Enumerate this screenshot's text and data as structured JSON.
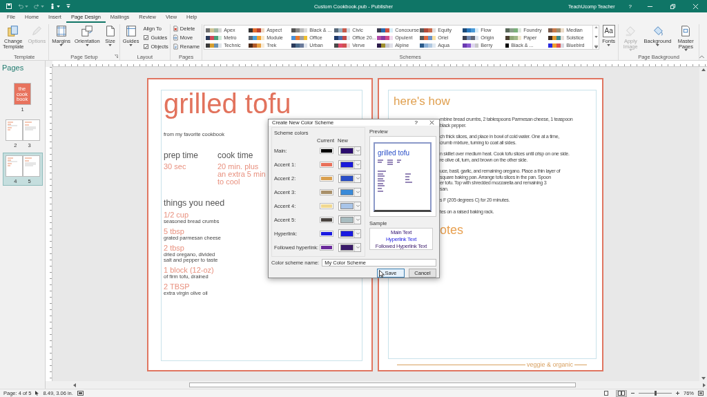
{
  "title_bar": {
    "quick_access": [
      {
        "kind": "save",
        "disabled": false,
        "dropdown": false
      },
      {
        "kind": "undo",
        "disabled": true,
        "dropdown": true
      },
      {
        "kind": "redo",
        "disabled": true,
        "dropdown": true
      },
      {
        "kind": "touch",
        "disabled": false,
        "dropdown": true
      },
      {
        "kind": "customize",
        "disabled": false,
        "dropdown": false
      }
    ],
    "document_title": "Custom Cookbook.pub - Publisher",
    "user": "TeachUcomp Teacher",
    "help": "?"
  },
  "tabs": [
    {
      "label": "File",
      "selected": false
    },
    {
      "label": "Home",
      "selected": false
    },
    {
      "label": "Insert",
      "selected": false
    },
    {
      "label": "Page Design",
      "selected": true
    },
    {
      "label": "Mailings",
      "selected": false
    },
    {
      "label": "Review",
      "selected": false
    },
    {
      "label": "View",
      "selected": false
    },
    {
      "label": "Help",
      "selected": false
    }
  ],
  "ribbon": {
    "groups": [
      {
        "label": "Template",
        "items": [
          {
            "kind": "large",
            "label": "Change Template",
            "disabled": false,
            "dropdown": false
          },
          {
            "kind": "large",
            "label": "Options",
            "disabled": true,
            "dropdown": false
          }
        ]
      },
      {
        "label": "Page Setup",
        "launcher": true,
        "items": [
          {
            "kind": "large",
            "label": "Margins",
            "disabled": false,
            "dropdown": true
          },
          {
            "kind": "large",
            "label": "Orientation",
            "disabled": false,
            "dropdown": true
          },
          {
            "kind": "large",
            "label": "Size",
            "disabled": false,
            "dropdown": true
          }
        ]
      },
      {
        "label": "Layout",
        "items": [
          {
            "kind": "large",
            "label": "Guides",
            "disabled": false,
            "dropdown": true
          },
          {
            "kind": "label",
            "label": "Align To"
          },
          {
            "kind": "checkbox",
            "label": "Guides",
            "checked": true
          },
          {
            "kind": "checkbox",
            "label": "Objects",
            "checked": true
          }
        ]
      },
      {
        "label": "Pages",
        "items": [
          {
            "kind": "small",
            "label": "Delete"
          },
          {
            "kind": "small",
            "label": "Move"
          },
          {
            "kind": "small",
            "label": "Rename"
          }
        ]
      },
      {
        "label": "Schemes",
        "items": [
          {
            "kind": "gallery",
            "schemes": [
              {
                "name": "Apex",
                "swatch": [
                  {
                    "color": "#6e6e6e"
                  },
                  {
                    "color": "#cec597"
                  },
                  {
                    "color": "#9fb8a3"
                  },
                  {
                    "color": "#d6d6d6"
                  }
                ]
              },
              {
                "name": "Aspect",
                "swatch": [
                  {
                    "color": "#323232"
                  },
                  {
                    "color": "#e36c2e"
                  },
                  {
                    "color": "#b8402e"
                  },
                  {
                    "color": "#f0d8c0"
                  }
                ]
              },
              {
                "name": "Black & ...",
                "swatch": [
                  {
                    "color": "#555555"
                  },
                  {
                    "color": "#8a8a8a"
                  },
                  {
                    "color": "#bcbcbc"
                  },
                  {
                    "color": "#dcdcdc"
                  }
                ]
              },
              {
                "name": "Civic",
                "swatch": [
                  {
                    "color": "#5a6a7a"
                  },
                  {
                    "color": "#9ab0c0"
                  },
                  {
                    "color": "#c85a4a"
                  },
                  {
                    "color": "#d0d8e0"
                  }
                ]
              },
              {
                "name": "Concourse",
                "swatch": [
                  {
                    "color": "#3c3c50"
                  },
                  {
                    "color": "#2a6ab0"
                  },
                  {
                    "color": "#d05040"
                  },
                  {
                    "color": "#d8ecf6"
                  }
                ]
              },
              {
                "name": "Equity",
                "swatch": [
                  {
                    "color": "#5a5a5a"
                  },
                  {
                    "color": "#b04a3a"
                  },
                  {
                    "color": "#c86a4a"
                  },
                  {
                    "color": "#e0e0e0"
                  }
                ]
              },
              {
                "name": "Flow",
                "swatch": [
                  {
                    "color": "#1a4a7a"
                  },
                  {
                    "color": "#2a7ac0"
                  },
                  {
                    "color": "#4a9ad8"
                  },
                  {
                    "color": "#d8ecf8"
                  }
                ]
              },
              {
                "name": "Foundry",
                "swatch": [
                  {
                    "color": "#5a6a5a"
                  },
                  {
                    "color": "#8aa08a"
                  },
                  {
                    "color": "#7ab07a"
                  },
                  {
                    "color": "#e0e8e0"
                  }
                ]
              },
              {
                "name": "Median",
                "swatch": [
                  {
                    "color": "#7a5a4a"
                  },
                  {
                    "color": "#c87a4a"
                  },
                  {
                    "color": "#a09070"
                  },
                  {
                    "color": "#ecdcc8"
                  }
                ]
              },
              {
                "name": "Metro",
                "swatch": [
                  {
                    "color": "#2a3a5a"
                  },
                  {
                    "color": "#d04a5a"
                  },
                  {
                    "color": "#4aa07a"
                  },
                  {
                    "color": "#d0e8d8"
                  }
                ]
              },
              {
                "name": "Module",
                "swatch": [
                  {
                    "color": "#5a6470"
                  },
                  {
                    "color": "#4aa0d8"
                  },
                  {
                    "color": "#f0a030"
                  },
                  {
                    "color": "#f8e8c8"
                  }
                ]
              },
              {
                "name": "Office",
                "swatch": [
                  {
                    "color": "#4a90d8"
                  },
                  {
                    "color": "#e87a30"
                  },
                  {
                    "color": "#a0a0a0"
                  },
                  {
                    "color": "#f0c030"
                  }
                ]
              },
              {
                "name": "Office 20...",
                "swatch": [
                  {
                    "color": "#1f3a6a"
                  },
                  {
                    "color": "#4a6aa8"
                  },
                  {
                    "color": "#c04a4a"
                  },
                  {
                    "color": "#e0e8f0"
                  }
                ]
              },
              {
                "name": "Opulent",
                "swatch": [
                  {
                    "color": "#b04aa8"
                  },
                  {
                    "color": "#8a3aa0"
                  },
                  {
                    "color": "#d04a8a"
                  },
                  {
                    "color": "#f0d8ec"
                  }
                ]
              },
              {
                "name": "Oriel",
                "swatch": [
                  {
                    "color": "#5a5a5a"
                  },
                  {
                    "color": "#e06a40"
                  },
                  {
                    "color": "#6a90c8"
                  },
                  {
                    "color": "#f8e0a0"
                  }
                ]
              },
              {
                "name": "Origin",
                "swatch": [
                  {
                    "color": "#3a4050"
                  },
                  {
                    "color": "#7088b0"
                  },
                  {
                    "color": "#606878"
                  },
                  {
                    "color": "#dde4ee"
                  }
                ]
              },
              {
                "name": "Paper",
                "swatch": [
                  {
                    "color": "#4a4030"
                  },
                  {
                    "color": "#90a878"
                  },
                  {
                    "color": "#a0b888"
                  },
                  {
                    "color": "#f0e8d0"
                  }
                ]
              },
              {
                "name": "Solstice",
                "swatch": [
                  {
                    "color": "#3a2a20"
                  },
                  {
                    "color": "#e09a30"
                  },
                  {
                    "color": "#3a8a8a"
                  },
                  {
                    "color": "#e8e0d8"
                  }
                ]
              },
              {
                "name": "Technic",
                "swatch": [
                  {
                    "color": "#3a3a3a"
                  },
                  {
                    "color": "#d8a030"
                  },
                  {
                    "color": "#6a90b0"
                  },
                  {
                    "color": "#e0e4e8"
                  }
                ]
              },
              {
                "name": "Trek",
                "swatch": [
                  {
                    "color": "#4a2a1a"
                  },
                  {
                    "color": "#b05a2a"
                  },
                  {
                    "color": "#e8a040"
                  },
                  {
                    "color": "#f8ecd8"
                  }
                ]
              },
              {
                "name": "Urban",
                "swatch": [
                  {
                    "color": "#2a3a5a"
                  },
                  {
                    "color": "#4a6a8a"
                  },
                  {
                    "color": "#6a7a9a"
                  },
                  {
                    "color": "#e0e4ec"
                  }
                ]
              },
              {
                "name": "Verve",
                "swatch": [
                  {
                    "color": "#4a4a4a"
                  },
                  {
                    "color": "#e04a6a"
                  },
                  {
                    "color": "#d05050"
                  },
                  {
                    "color": "#f0d8d8"
                  }
                ]
              },
              {
                "name": "Alpine",
                "swatch": [
                  {
                    "color": "#2a1a4a"
                  },
                  {
                    "color": "#a09030"
                  },
                  {
                    "color": "#c8c8d0"
                  },
                  {
                    "color": "#e0e0e8"
                  }
                ]
              },
              {
                "name": "Aqua",
                "swatch": [
                  {
                    "color": "#2a5a8a"
                  },
                  {
                    "color": "#8ab0d8"
                  },
                  {
                    "color": "#b0c8e0"
                  },
                  {
                    "color": "#e0e8f0"
                  }
                ]
              },
              {
                "name": "Berry",
                "swatch": [
                  {
                    "color": "#6a3ab0"
                  },
                  {
                    "color": "#8a5ad0"
                  },
                  {
                    "color": "#e0d8f0"
                  },
                  {
                    "color": "#c8c8c8"
                  }
                ]
              },
              {
                "name": "Black & ...",
                "swatch": [
                  {
                    "color": "#000000"
                  }
                ]
              },
              {
                "name": "Bluebird",
                "swatch": [
                  {
                    "color": "#2a2ae0"
                  },
                  {
                    "color": "#f0a030"
                  },
                  {
                    "color": "#e05050"
                  },
                  {
                    "color": "#d8d8e0"
                  }
                ]
              }
            ]
          },
          {
            "kind": "large",
            "glyph": "Aa",
            "label": "Fonts",
            "disabled": false,
            "dropdown": true
          }
        ]
      },
      {
        "label": "Page Background",
        "items": [
          {
            "kind": "large",
            "label": "Apply Image",
            "disabled": true,
            "dropdown": true
          },
          {
            "kind": "large",
            "label": "Background",
            "disabled": false,
            "dropdown": true
          },
          {
            "kind": "large",
            "label": "Master Pages",
            "disabled": false,
            "dropdown": true
          }
        ]
      }
    ]
  },
  "pages_pane": {
    "title": "Pages",
    "thumbnails": [
      {
        "kind": "cover",
        "cover_text": "the cook book",
        "numbers": [
          "1"
        ],
        "selected": false
      },
      {
        "kind": "spread",
        "numbers": [
          "2",
          "3"
        ],
        "selected": false
      },
      {
        "kind": "spread",
        "numbers": [
          "4",
          "5"
        ],
        "selected": true
      }
    ]
  },
  "document": {
    "left_page": {
      "title": "grilled tofu",
      "subtitle": "from my favorite cookbook",
      "times": [
        {
          "label": "prep time",
          "value": "30 sec"
        },
        {
          "label": "cook time",
          "value": "20 min. plus an extra 5 min to cool"
        }
      ],
      "needs_heading": "things you need",
      "ingredients": [
        {
          "amount": "1/2 cup",
          "lines": [
            "seasoned bread crumbs"
          ]
        },
        {
          "amount": "5 tbsp",
          "lines": [
            "grated parmesan cheese"
          ]
        },
        {
          "amount": "2 tbsp",
          "lines": [
            "dried oregano, divided",
            "salt and pepper to taste"
          ]
        },
        {
          "amount": "1 block (12-oz)",
          "lines": [
            "of firm tofu, drained"
          ]
        },
        {
          "amount": "2 TBSP",
          "lines": [
            "extra virgin olive oil"
          ]
        }
      ]
    },
    "right_page": {
      "heading": "here's how",
      "steps": [
        {
          "lines": [
            "mbine bread crumbs, 2 tablespoons Parmesan cheese, 1 teaspoon",
            "black pepper."
          ]
        },
        {
          "lines": [
            "ch thick slices, and place in bowl of cold water. One at a time,",
            "crumb mixture, turning to coat all sides."
          ]
        },
        {
          "lines": [
            "n skillet over medium heat. Cook tofu slices until crisp on one side.",
            "re olive oil, turn, and brown on the other side."
          ]
        },
        {
          "lines": [
            "uce, basil, garlic, and remaining oregano. Place a thin layer of",
            "square baking pan. Arrange tofu slices in the pan. Spoon",
            "er tofu. Top with shredded mozzarella and remaining 3",
            "san."
          ]
        },
        {
          "lines": [
            "s F (205 degrees C) for 20 minutes."
          ]
        },
        {
          "lines": [
            "tes on a raised baking rack."
          ]
        }
      ],
      "notes_heading": "otes",
      "footer": "veggie & organic"
    }
  },
  "dialog": {
    "title": "Create New Color Scheme",
    "help": "?",
    "scheme_colors_label": "Scheme colors",
    "columns": [
      "Current",
      "New"
    ],
    "rows": [
      {
        "label": "Main:",
        "current": {
          "color": "#000000"
        },
        "new": {
          "color": "#2b0c6e"
        }
      },
      {
        "label": "Accent 1:",
        "current": {
          "color": "#e8705a"
        },
        "new": {
          "color": "#1a1adb"
        }
      },
      {
        "label": "Accent 2:",
        "current": {
          "color": "#d9a050"
        },
        "new": {
          "color": "#2a4fc8"
        }
      },
      {
        "label": "Accent 3:",
        "current": {
          "color": "#a8906a"
        },
        "new": {
          "color": "#3a8ad8"
        }
      },
      {
        "label": "Accent 4:",
        "current": {
          "color": "#f0d890"
        },
        "new": {
          "color": "#a8c4e8"
        }
      },
      {
        "label": "Accent 5:",
        "current": {
          "color": "#4a4440"
        },
        "new": {
          "color": "#a8bcc0"
        }
      },
      {
        "label": "Hyperlink:",
        "current": {
          "color": "#1a1ae0"
        },
        "new": {
          "color": "#1a1ae0"
        }
      },
      {
        "label": "Followed hyperlink:",
        "current": {
          "color": "#6a2a9a"
        },
        "new": {
          "color": "#3a1a6a"
        }
      }
    ],
    "preview_label": "Preview",
    "preview_title": "grilled tofu",
    "sample_label": "Sample",
    "sample_texts": [
      "Main Text",
      "Hyperlink Text",
      "Followed Hyperlink Text"
    ],
    "name_label": "Color scheme name:",
    "name_value": "My Color Scheme",
    "buttons": [
      {
        "label": "Save",
        "default": true
      },
      {
        "label": "Cancel",
        "default": false
      }
    ]
  },
  "status_bar": {
    "page": "Page: 4 of 5",
    "position": "8.49, 3.06 in.",
    "views": [
      {
        "kind": "single",
        "selected": false
      },
      {
        "kind": "two",
        "selected": true
      }
    ],
    "zoom": {
      "level": 0.5,
      "reading": "76%"
    }
  }
}
